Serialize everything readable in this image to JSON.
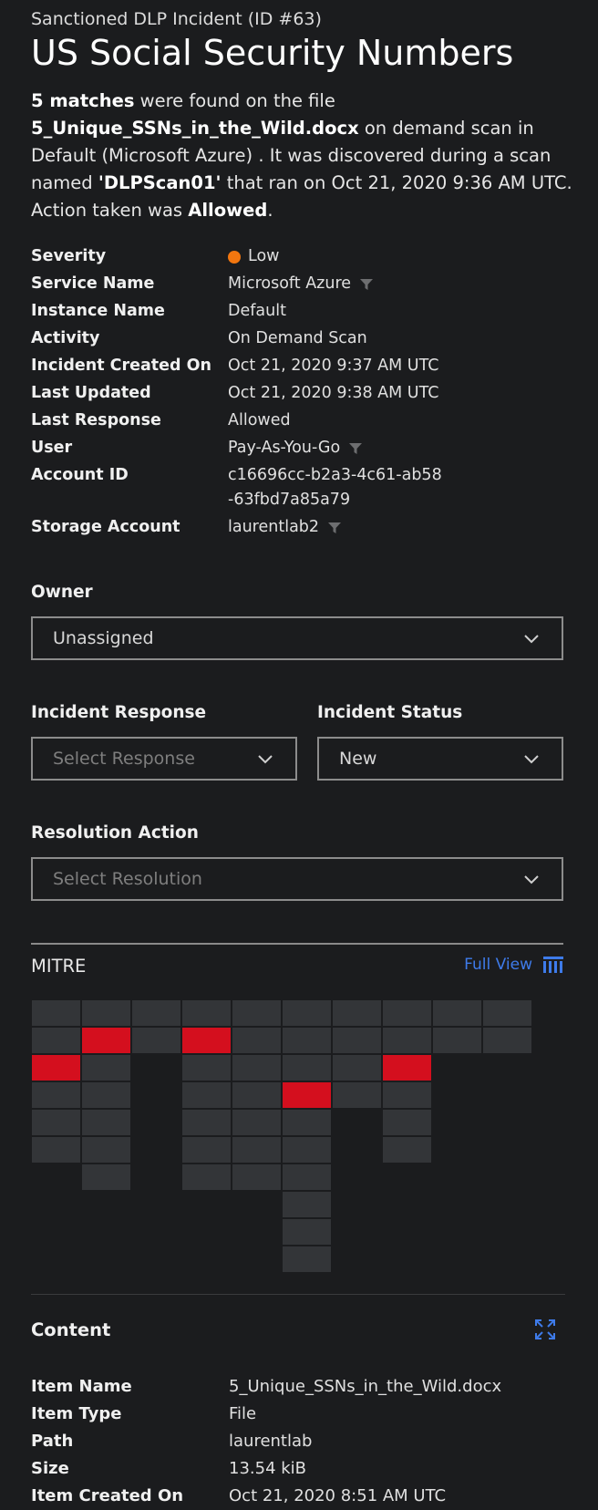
{
  "header": {
    "subtitle": "Sanctioned DLP Incident (ID #63)",
    "title": "US Social Security Numbers"
  },
  "summary": {
    "matches": "5 matches",
    "t1": " were found on the file ",
    "file": "5_Unique_SSNs_in_the_Wild.docx",
    "t2": " on demand scan in Default (Microsoft Azure) . It was discovered during a scan named ",
    "scan": "'DLPScan01'",
    "t3": " that ran on Oct 21, 2020 9:36 AM UTC. Action taken was ",
    "action": "Allowed",
    "t4": "."
  },
  "fields": [
    {
      "label": "Severity",
      "value": "Low",
      "dot": true
    },
    {
      "label": "Service Name",
      "value": "Microsoft Azure",
      "filter": true
    },
    {
      "label": "Instance Name",
      "value": "Default"
    },
    {
      "label": "Activity",
      "value": "On Demand Scan"
    },
    {
      "label": "Incident Created On",
      "value": "Oct 21, 2020 9:37 AM UTC"
    },
    {
      "label": "Last Updated",
      "value": "Oct 21, 2020 9:38 AM UTC"
    },
    {
      "label": "Last Response",
      "value": "Allowed"
    },
    {
      "label": "User",
      "value": "Pay-As-You-Go",
      "filter": true
    },
    {
      "label": "Account ID",
      "value": "c16696cc-b2a3-4c61-ab58-63fbd7a85a79"
    },
    {
      "label": "Storage Account",
      "value": "laurentlab2",
      "filter": true
    }
  ],
  "owner": {
    "label": "Owner",
    "value": "Unassigned"
  },
  "incident_response": {
    "label": "Incident Response",
    "placeholder": "Select Response"
  },
  "incident_status": {
    "label": "Incident Status",
    "value": "New"
  },
  "resolution": {
    "label": "Resolution Action",
    "placeholder": "Select Resolution"
  },
  "mitre": {
    "label": "MITRE",
    "full_view": "Full View",
    "columns": [
      {
        "count": 6,
        "red": [
          2
        ]
      },
      {
        "count": 7,
        "red": [
          1
        ]
      },
      {
        "count": 2,
        "red": []
      },
      {
        "count": 7,
        "red": [
          1
        ]
      },
      {
        "count": 7,
        "red": []
      },
      {
        "count": 10,
        "red": [
          3
        ]
      },
      {
        "count": 4,
        "red": []
      },
      {
        "count": 6,
        "red": [
          2
        ]
      },
      {
        "count": 2,
        "red": []
      },
      {
        "count": 2,
        "red": []
      }
    ]
  },
  "content": {
    "label": "Content",
    "items": [
      {
        "label": "Item Name",
        "value": "5_Unique_SSNs_in_the_Wild.docx"
      },
      {
        "label": "Item Type",
        "value": "File"
      },
      {
        "label": "Path",
        "value": "laurentlab"
      },
      {
        "label": "Size",
        "value": "13.54 kiB"
      },
      {
        "label": "Item Created On",
        "value": "Oct 21, 2020 8:51 AM UTC"
      }
    ]
  },
  "colors": {
    "accent": "#3e7bea",
    "severity_low": "#f2760f",
    "mitre_hit": "#d40f1e"
  }
}
